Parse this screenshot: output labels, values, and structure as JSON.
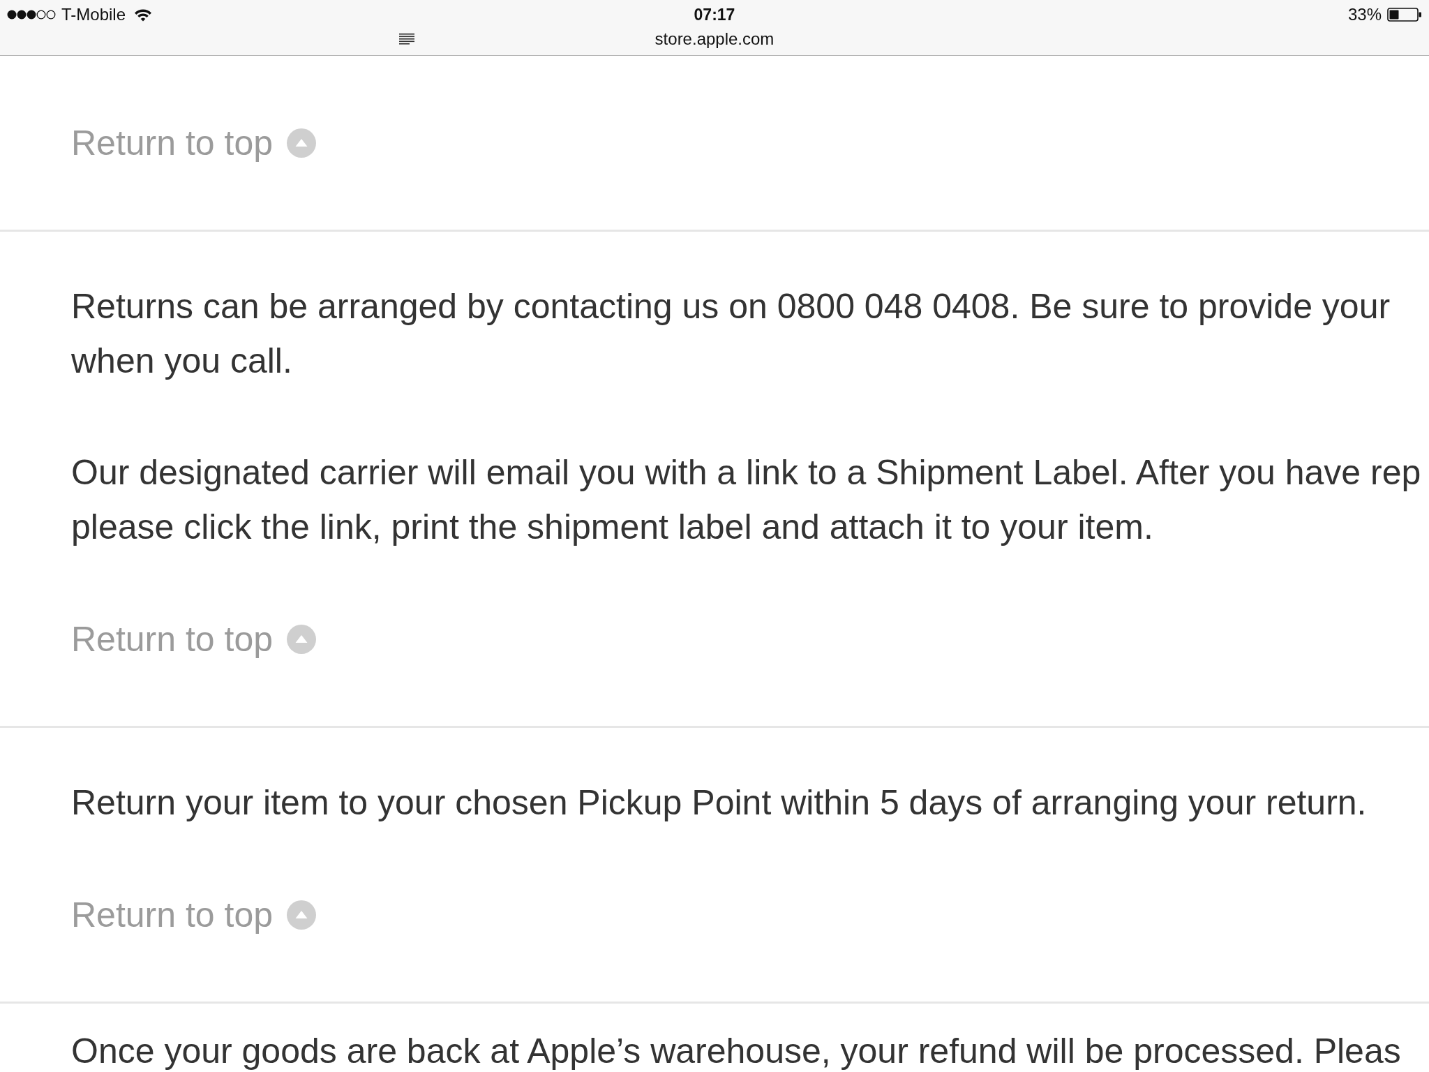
{
  "status_bar": {
    "carrier": "T-Mobile",
    "time": "07:17",
    "battery": "33%"
  },
  "address_bar": {
    "url": "store.apple.com"
  },
  "sections": [
    {
      "link": "Return to top"
    },
    {
      "paragraphs": [
        {
          "lines": [
            "Returns can be arranged by contacting us on 0800 048 0408. Be sure to provide your",
            "when you call."
          ]
        },
        {
          "lines": [
            "Our designated carrier will email you with a link to a Shipment Label. After you have rep",
            "please click the link, print the shipment label and attach it to your item."
          ]
        }
      ],
      "link": "Return to top"
    },
    {
      "paragraphs": [
        {
          "lines": [
            "Return your item to your chosen Pickup Point within 5 days of arranging your return."
          ]
        }
      ],
      "link": "Return to top"
    },
    {
      "paragraphs": [
        {
          "lines": [
            "Once your goods are back at Apple’s warehouse, your refund will be processed. Pleas"
          ]
        }
      ]
    }
  ]
}
